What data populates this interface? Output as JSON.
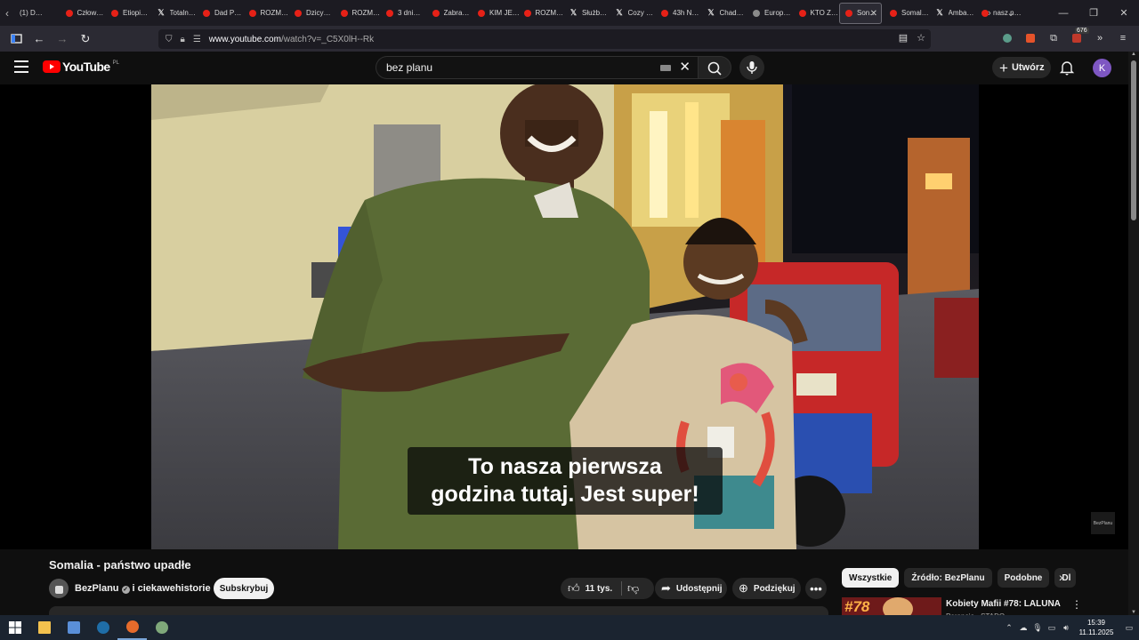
{
  "browser": {
    "tabs": [
      {
        "title": "(1) D…",
        "icon": "none"
      },
      {
        "title": "Człow…",
        "icon": "youtube-icon"
      },
      {
        "title": "Etiopi…",
        "icon": "youtube-icon"
      },
      {
        "title": "Totaln…",
        "icon": "x-icon"
      },
      {
        "title": "Dad P…",
        "icon": "youtube-icon"
      },
      {
        "title": "ROZM…",
        "icon": "youtube-icon"
      },
      {
        "title": "Dzicy…",
        "icon": "youtube-icon"
      },
      {
        "title": "ROZM…",
        "icon": "youtube-icon"
      },
      {
        "title": "3 dni…",
        "icon": "youtube-icon"
      },
      {
        "title": "Zabra…",
        "icon": "youtube-icon"
      },
      {
        "title": "KIM JE…",
        "icon": "youtube-icon"
      },
      {
        "title": "ROZM…",
        "icon": "youtube-icon"
      },
      {
        "title": "Służb…",
        "icon": "x-icon"
      },
      {
        "title": "Cozy …",
        "icon": "x-icon"
      },
      {
        "title": "43h N…",
        "icon": "youtube-icon"
      },
      {
        "title": "Chad…",
        "icon": "x-icon"
      },
      {
        "title": "Europ…",
        "icon": "globe-icon"
      },
      {
        "title": "KTO Z…",
        "icon": "youtube-icon"
      },
      {
        "title": "Son…",
        "icon": "youtube-icon",
        "active": true
      },
      {
        "title": "Somal…",
        "icon": "youtube-icon"
      },
      {
        "title": "Amba…",
        "icon": "x-icon"
      },
      {
        "title": "nasz n…",
        "icon": "youtube-icon"
      }
    ],
    "url_host": "www.youtube.com",
    "url_path": "/watch?v=_C5X0lH--Rk",
    "extension_badge": "676"
  },
  "youtube": {
    "logo_text": "YouTube",
    "country_code": "PL",
    "search_value": "bez planu",
    "create_label": "Utwórz",
    "avatar_letter": "K"
  },
  "video": {
    "caption_line1": "To nasza pierwsza",
    "caption_line2": "godzina tutaj. Jest super!",
    "watermark": "BezPlanu",
    "title": "Somalia - państwo upadłe",
    "channel_name": "BezPlanu",
    "channel_collab": "i ciekawehistorie",
    "subscribe_label": "Subskrybuj",
    "likes": "11 tys.",
    "share_label": "Udostępnij",
    "thanks_label": "Podziękuj"
  },
  "sidebar": {
    "chips": [
      "Wszystkie",
      "Źródło: BezPlanu",
      "Podobne",
      "Dl"
    ],
    "recommendation": {
      "title": "Kobiety Mafii #78: LALUNA",
      "meta": "Paranoja · STADO",
      "thumb_text": "#78"
    }
  },
  "taskbar": {
    "time": "15:39",
    "date": "11.11.2025"
  },
  "colors": {
    "yt_red": "#ff0000",
    "bg": "#0f0f0f",
    "avatar": "#7e57c2"
  }
}
